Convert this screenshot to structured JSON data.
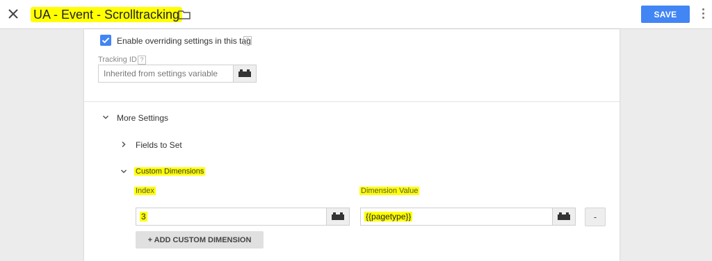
{
  "header": {
    "title": "UA - Event - Scrolltracking",
    "save_label": "SAVE"
  },
  "settings": {
    "override_label": "Enable overriding settings in this tag",
    "override_checked": true,
    "help_glyph": "?",
    "tracking_id_label": "Tracking ID",
    "tracking_id_placeholder": "Inherited from settings variable"
  },
  "more_settings": {
    "label": "More Settings",
    "fields_to_set_label": "Fields to Set",
    "custom_dimensions_label": "Custom Dimensions",
    "index_label": "Index",
    "dimension_value_label": "Dimension Value",
    "rows": [
      {
        "index": "3",
        "value": "{{pagetype}}",
        "remove_label": "-"
      }
    ],
    "add_label": "+ ADD CUSTOM DIMENSION"
  },
  "colors": {
    "accent": "#4285f4",
    "highlight": "#ffff00"
  },
  "icons": {
    "close": "close-icon",
    "folder": "folder-icon",
    "more": "more-vert-icon",
    "variable": "variable-picker-icon",
    "help": "help-icon",
    "chevron_down": "chevron-down-icon",
    "chevron_right": "chevron-right-icon"
  }
}
